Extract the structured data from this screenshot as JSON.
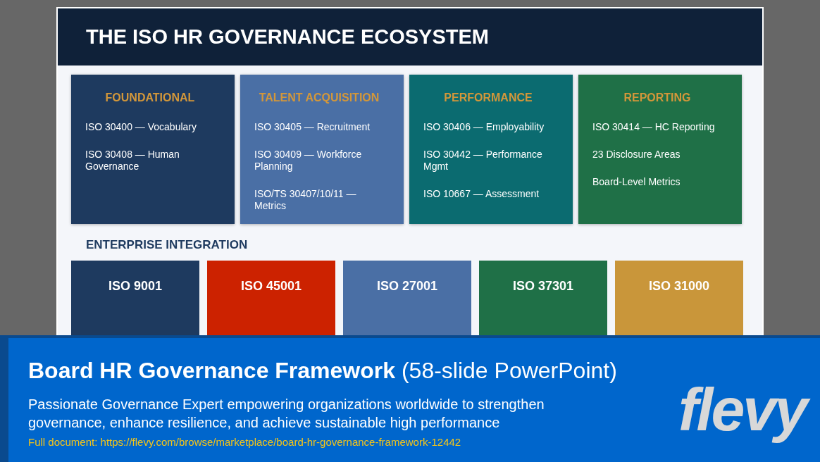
{
  "slide": {
    "title": "THE ISO HR GOVERNANCE ECOSYSTEM",
    "categories": [
      {
        "title": "FOUNDATIONAL",
        "color": "#1e3a5f",
        "items": [
          "ISO 30400 — Vocabulary",
          "ISO 30408 — Human Governance"
        ]
      },
      {
        "title": "TALENT ACQUISITION",
        "color": "#4a6fa5",
        "items": [
          "ISO 30405 — Recruitment",
          "ISO 30409 — Workforce Planning",
          "ISO/TS 30407/10/11 — Metrics"
        ]
      },
      {
        "title": "PERFORMANCE",
        "color": "#0b6b70",
        "items": [
          "ISO 30406 — Employability",
          "ISO 30442 — Performance Mgmt",
          "ISO 10667 — Assessment"
        ]
      },
      {
        "title": "REPORTING",
        "color": "#1f7047",
        "items": [
          "ISO 30414 — HC Reporting",
          "23 Disclosure Areas",
          "Board-Level Metrics"
        ]
      }
    ],
    "integration": {
      "heading": "ENTERPRISE INTEGRATION",
      "standards": [
        {
          "title": "ISO 9001",
          "color": "#1e3a5f"
        },
        {
          "title": "ISO 45001",
          "color": "#cc2200"
        },
        {
          "title": "ISO 27001",
          "color": "#4a6fa5"
        },
        {
          "title": "ISO 37301",
          "color": "#1f7047"
        },
        {
          "title": "ISO 31000",
          "color": "#c9963a"
        }
      ]
    }
  },
  "banner": {
    "title": "**Board HR Governance Framework** (58-slide PowerPoint)",
    "description": "Passionate Governance Expert empowering organizations worldwide to strengthen governance, enhance resilience, and achieve sustainable high performance",
    "link": "Full document: https://flevy.com/browse/marketplace/board-hr-governance-framework-12442",
    "logo": "flevy"
  }
}
